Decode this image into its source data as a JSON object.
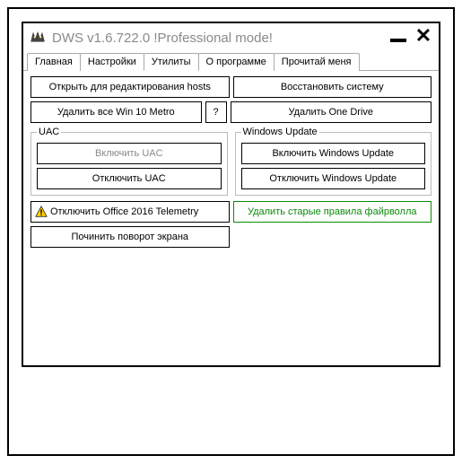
{
  "window": {
    "title": "DWS v1.6.722.0  !Professional mode!"
  },
  "tabs": [
    {
      "label": "Главная"
    },
    {
      "label": "Настройки"
    },
    {
      "label": "Утилиты"
    },
    {
      "label": "О программе"
    },
    {
      "label": "Прочитай меня"
    }
  ],
  "activeTabIndex": 2,
  "buttons": {
    "openHosts": "Открыть для редактирования hosts",
    "restoreSystem": "Восстановить систему",
    "removeMetro": "Удалить все Win 10 Metro",
    "question": "?",
    "removeOneDrive": "Удалить One Drive",
    "enableUAC": "Включить UAC",
    "disableUAC": "Отключить UAC",
    "enableWU": "Включить Windows Update",
    "disableWU": "Отключить Windows Update",
    "disableOfficeTelemetry": "Отключить Office 2016 Telemetry",
    "removeFirewallRules": "Удалить старые правила файрволла",
    "fixRotation": "Починить поворот экрана"
  },
  "groups": {
    "uac": "UAC",
    "wu": "Windows Update"
  }
}
